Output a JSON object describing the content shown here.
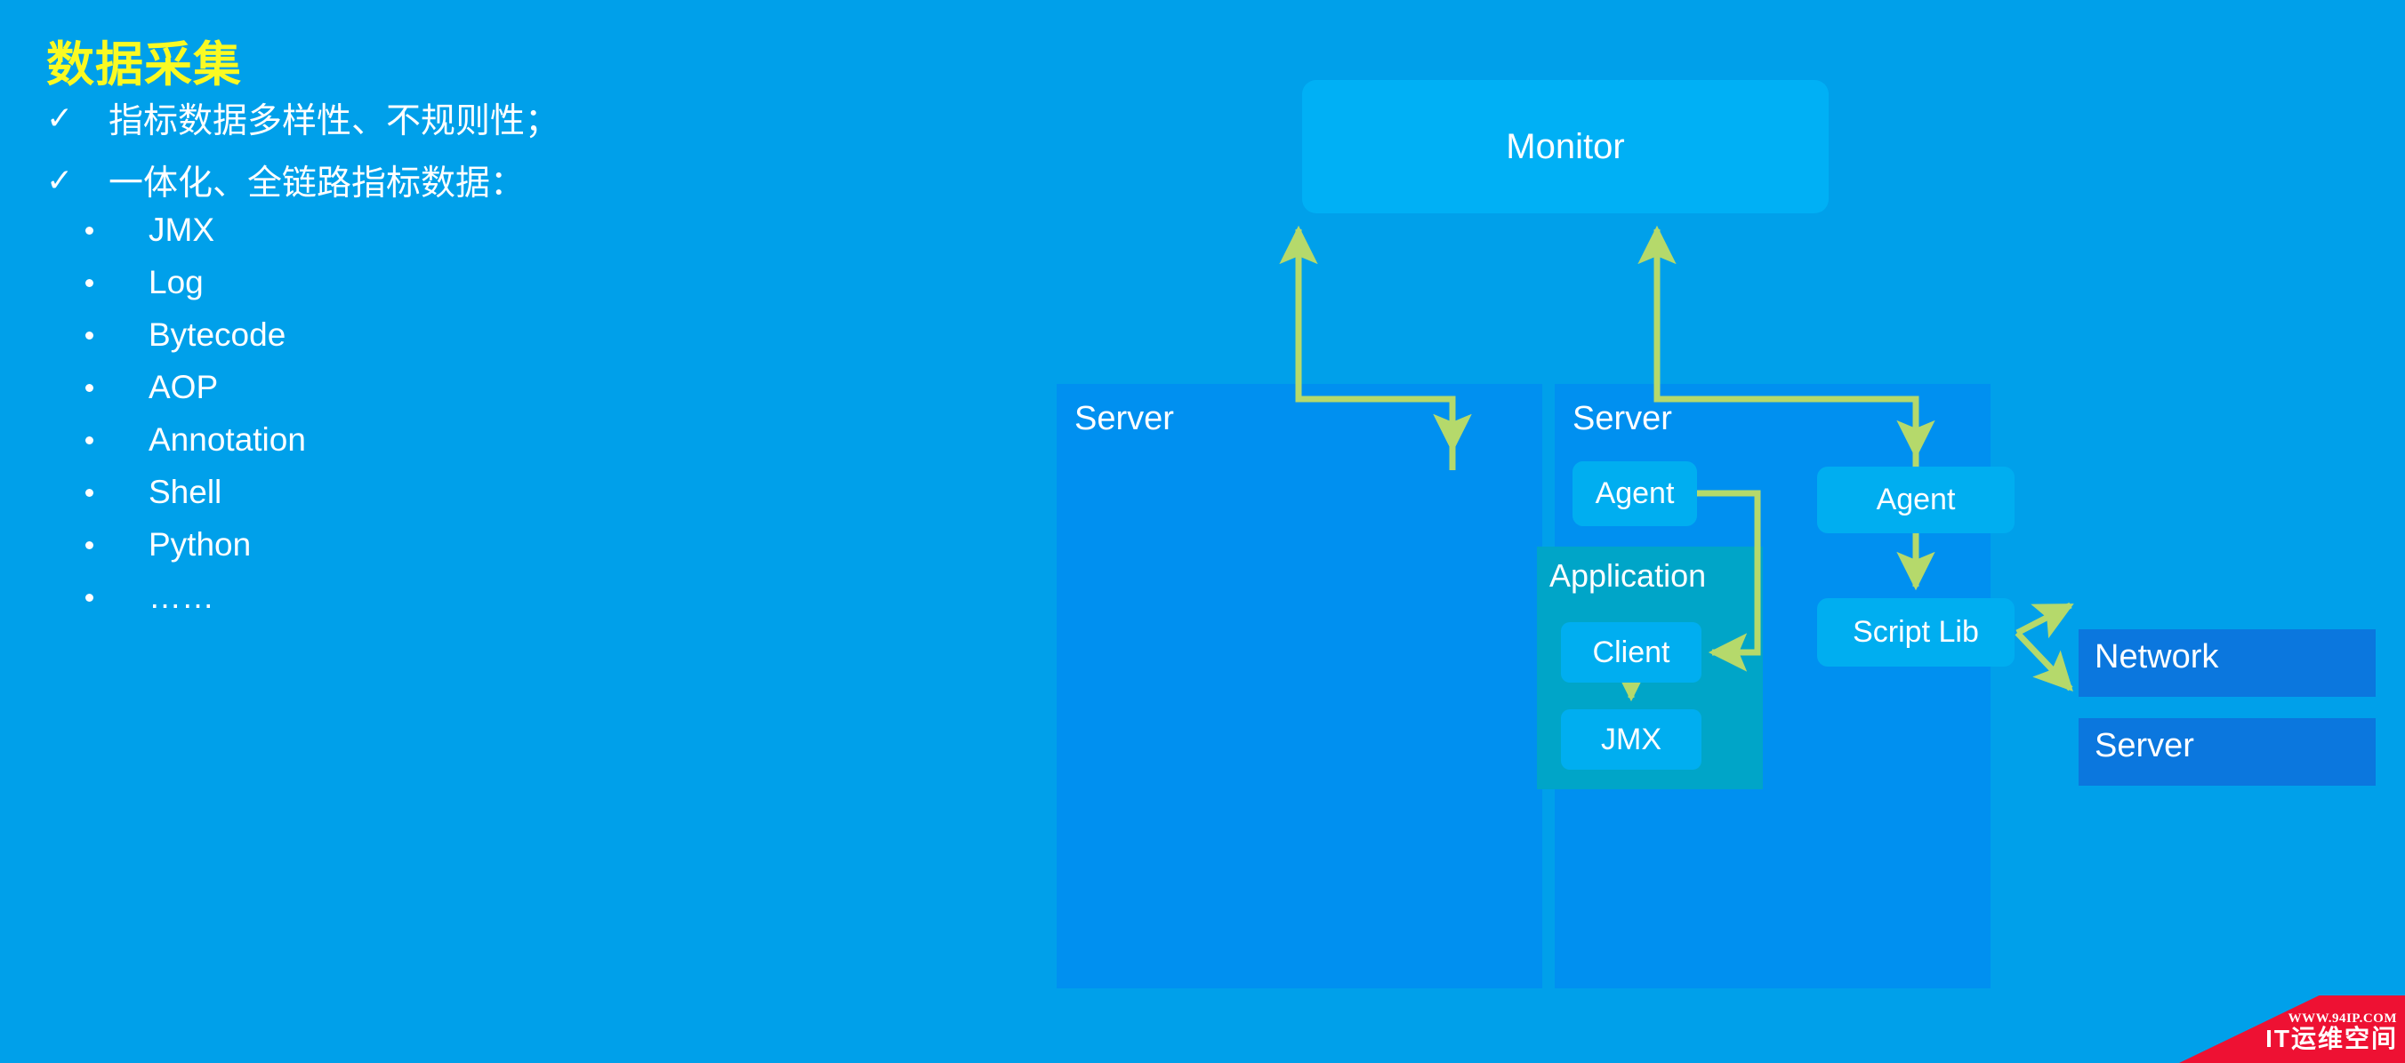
{
  "slide": {
    "background_color": "#00A0EA",
    "title": "数据采集",
    "title_color": "#FAFA22"
  },
  "bullets": {
    "check_icon": "check-mark-icon",
    "items": [
      {
        "text": "指标数据多样性、不规则性；"
      },
      {
        "text": "一体化、全链路指标数据："
      }
    ]
  },
  "sub_bullets": {
    "dot_icon": "bullet-dot-icon",
    "items": [
      {
        "label": "JMX"
      },
      {
        "label": "Log"
      },
      {
        "label": "Bytecode"
      },
      {
        "label": "AOP"
      },
      {
        "label": "Annotation"
      },
      {
        "label": "Shell"
      },
      {
        "label": "Python"
      },
      {
        "label": "……"
      }
    ]
  },
  "diagram": {
    "monitor": {
      "label": "Monitor",
      "color": "#00B0F5"
    },
    "server_left": {
      "label": "Server",
      "color": "#0090F0",
      "agent": {
        "label": "Agent",
        "color": "#00AEF0"
      },
      "application": {
        "label": "Application",
        "color": "#00A5C8",
        "client": {
          "label": "Client",
          "color": "#00AEF0"
        },
        "jmx": {
          "label": "JMX",
          "color": "#00AEF0"
        }
      }
    },
    "server_right": {
      "label": "Server",
      "color": "#0090F0",
      "agent": {
        "label": "Agent",
        "color": "#00AEF0"
      },
      "script_lib": {
        "label": "Script Lib",
        "color": "#00AEF0"
      }
    },
    "externals": [
      {
        "label": "Network",
        "color": "#0B77DE"
      },
      {
        "label": "Server",
        "color": "#0B77DE"
      }
    ],
    "arrow_color": "#B5D96B"
  },
  "watermark": {
    "url": "WWW.94IP.COM",
    "name": "IT运维空间",
    "banner_color": "#EE1133"
  }
}
